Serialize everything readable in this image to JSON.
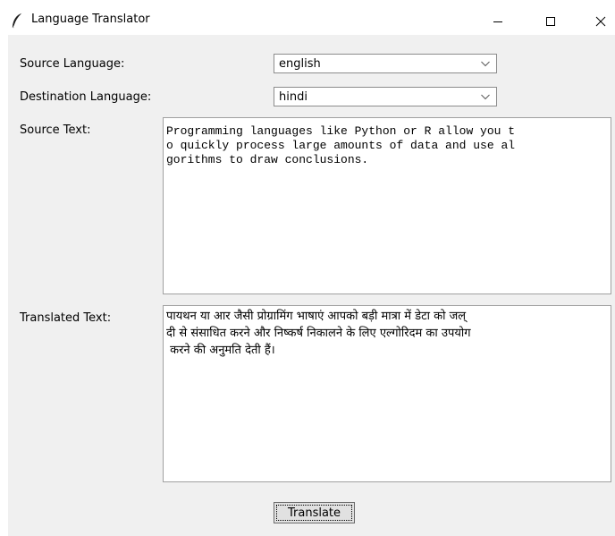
{
  "window": {
    "title": "Language Translator",
    "app_icon": "feather-icon",
    "controls": {
      "minimize_icon": "minimize-icon",
      "maximize_icon": "maximize-icon",
      "close_icon": "close-icon"
    }
  },
  "form": {
    "source_language": {
      "label": "Source Language:",
      "value": "english"
    },
    "destination_language": {
      "label": "Destination Language:",
      "value": "hindi"
    },
    "source_text": {
      "label": "Source Text:",
      "value": "Programming languages like Python or R allow you t\no quickly process large amounts of data and use al\ngorithms to draw conclusions."
    },
    "translated_text": {
      "label": "Translated Text:",
      "value": "पायथन या आर जैसी प्रोग्रामिंग भाषाएं आपको बड़ी मात्रा में डेटा को जल्\nदी से संसाधित करने और निष्कर्ष निकालने के लिए एल्गोरिदम का उपयोग\n करने की अनुमति देती हैं।"
    },
    "translate_button": "Translate"
  }
}
